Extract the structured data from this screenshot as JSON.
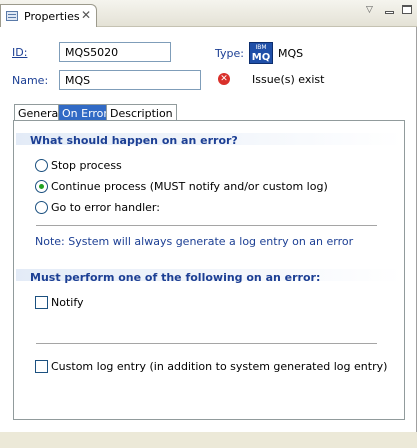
{
  "view": {
    "title": "Properties",
    "close_icon": "✕",
    "menu_icon": "▽"
  },
  "header": {
    "id_label": "ID:",
    "id_value": "MQS5020",
    "name_label": "Name:",
    "name_value": "MQS",
    "type_label": "Type:",
    "type_value": "MQS",
    "logo_top": "IBM",
    "logo_bottom": "MQ",
    "issues_text": "Issue(s) exist"
  },
  "tabs": [
    {
      "label": "General",
      "selected": false
    },
    {
      "label": "On Error",
      "selected": true
    },
    {
      "label": "Description",
      "selected": false
    }
  ],
  "on_error": {
    "section1_title": "What should happen on an error?",
    "options": [
      {
        "label": "Stop process",
        "checked": false
      },
      {
        "label": "Continue process (MUST notify and/or custom log)",
        "checked": true
      },
      {
        "label": "Go to error handler:",
        "checked": false
      }
    ],
    "note": "Note: System will always generate a log entry on an error",
    "section2_title": "Must perform one of the following on an error:",
    "notify_label": "Notify",
    "notify_checked": false,
    "custom_log_label": "Custom log entry (in addition to system generated log entry)",
    "custom_log_checked": false
  },
  "colors": {
    "accent": "#1c3f94",
    "tab_selected": "#316ac5",
    "radio_selected": "#21a121",
    "error": "#d9302a"
  }
}
